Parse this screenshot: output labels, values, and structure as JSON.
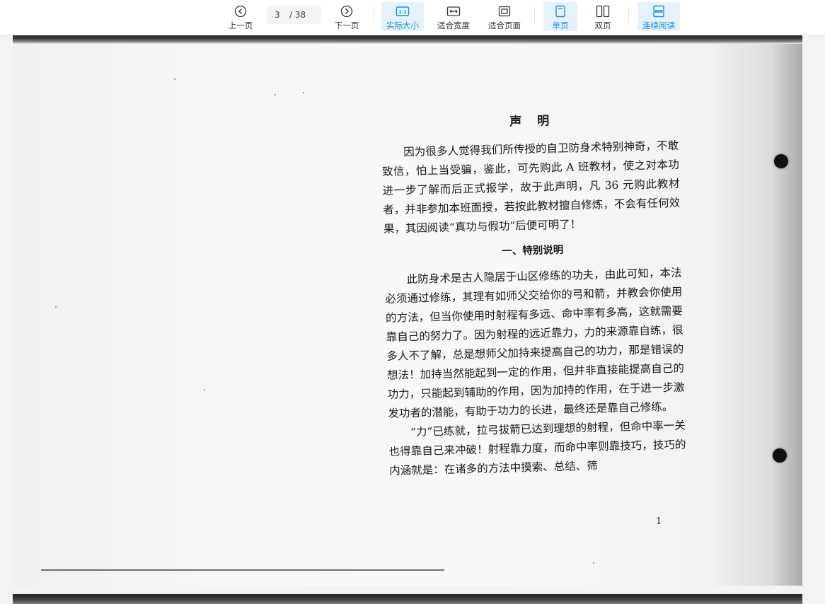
{
  "toolbar": {
    "prev_label": "上一页",
    "next_label": "下一页",
    "current_page": "3",
    "total_pages": "/ 38",
    "actual_size_label": "实际大小",
    "fit_width_label": "适合宽度",
    "fit_page_label": "适合页面",
    "single_page_label": "单页",
    "double_page_label": "双页",
    "continuous_label": "连续阅读",
    "accent_color": "#1c8fe0"
  },
  "document": {
    "title": "声明",
    "intro_paragraph": "因为很多人觉得我们所传授的自卫防身术特别神奇，不敢致信，怕上当受骗，鉴此，可先购此 A 班教材，使之对本功进一步了解而后正式报学，故于此声明，凡 36 元购此教材者，并非参加本班面授，若按此教材擅自修炼，不会有任何效果，其因阅读“真功与假功”后便可明了！",
    "section_heading": "一、特别说明",
    "section_paragraph_1": "此防身术是古人隐居于山区修练的功夫，由此可知，本法必须通过修练，其理有如师父交给你的弓和箭，并教会你使用的方法，但当你使用时射程有多远、命中率有多高，这就需要靠自己的努力了。因为射程的远近靠力，力的来源靠自练，很多人不了解，总是想师父加持来提高自己的功力，那是错误的想法！加持当然能起到一定的作用，但并非直接能提高自己的功力，只能起到辅助的作用，因为加持的作用，在于进一步激发功者的潜能，有助于功力的长进，最终还是靠自己修练。",
    "section_paragraph_2": "“力”已练就，拉弓拔箭已达到理想的射程，但命中率一关也得靠自己来冲破！射程靠力度，而命中率则靠技巧，技巧的内涵就是：在诸多的方法中摸索、总结、筛",
    "page_number": "1"
  }
}
